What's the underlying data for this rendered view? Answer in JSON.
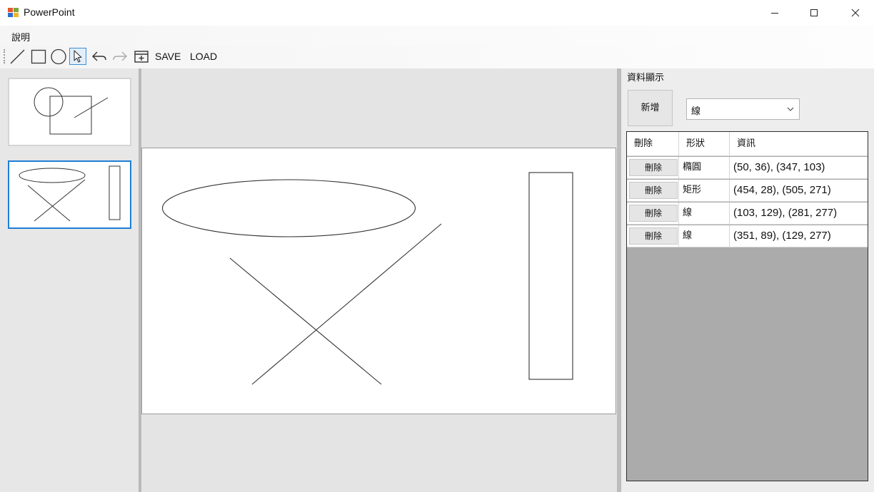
{
  "window": {
    "title": "PowerPoint",
    "controls": [
      "minimize",
      "maximize",
      "close"
    ]
  },
  "menu": {
    "help_label": "說明"
  },
  "toolbar": {
    "tools": [
      "line-icon",
      "rectangle-icon",
      "ellipse-icon",
      "pointer-icon",
      "undo-icon",
      "redo-icon",
      "add-slide-icon"
    ],
    "active_tool": "pointer-icon",
    "save_label": "SAVE",
    "load_label": "LOAD"
  },
  "slides_panel": {
    "thumbnail_count": 2,
    "selected_index": 1
  },
  "data_panel": {
    "group_title": "資料顯示",
    "add_button": "新增",
    "shape_select": {
      "value": "線"
    },
    "grid": {
      "headers": [
        "刪除",
        "形狀",
        "資訊"
      ],
      "delete_label": "刪除",
      "rows": [
        {
          "shape": "橢圓",
          "info": "(50, 36), (347, 103)"
        },
        {
          "shape": "矩形",
          "info": "(454, 28), (505, 271)"
        },
        {
          "shape": "線",
          "info": "(103, 129), (281, 277)"
        },
        {
          "shape": "線",
          "info": "(351, 89), (129, 277)"
        }
      ]
    }
  },
  "colors": {
    "selection_border": "#1e7fd7",
    "active_tool_border": "#3c8fd6",
    "grid_background": "#ababab",
    "shape_stroke": "#333333"
  }
}
